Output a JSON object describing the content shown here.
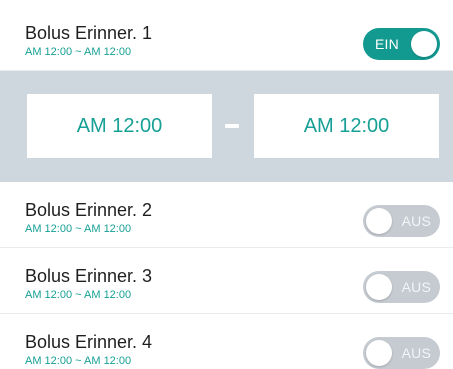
{
  "reminders": [
    {
      "title": "Bolus Erinner. 1",
      "time": "AM 12:00 ~ AM 12:00",
      "toggle_label": "EIN",
      "enabled": true
    },
    {
      "title": "Bolus Erinner. 2",
      "time": "AM 12:00 ~ AM 12:00",
      "toggle_label": "AUS",
      "enabled": false
    },
    {
      "title": "Bolus Erinner. 3",
      "time": "AM 12:00 ~ AM 12:00",
      "toggle_label": "AUS",
      "enabled": false
    },
    {
      "title": "Bolus Erinner. 4",
      "time": "AM 12:00 ~ AM 12:00",
      "toggle_label": "AUS",
      "enabled": false
    }
  ],
  "time_picker": {
    "start": "AM 12:00",
    "end": "AM 12:00"
  },
  "colors": {
    "accent": "#139a90",
    "panel": "#ced6de",
    "toggle_off": "#c5cbd1",
    "title_text": "#1f1f1f"
  }
}
